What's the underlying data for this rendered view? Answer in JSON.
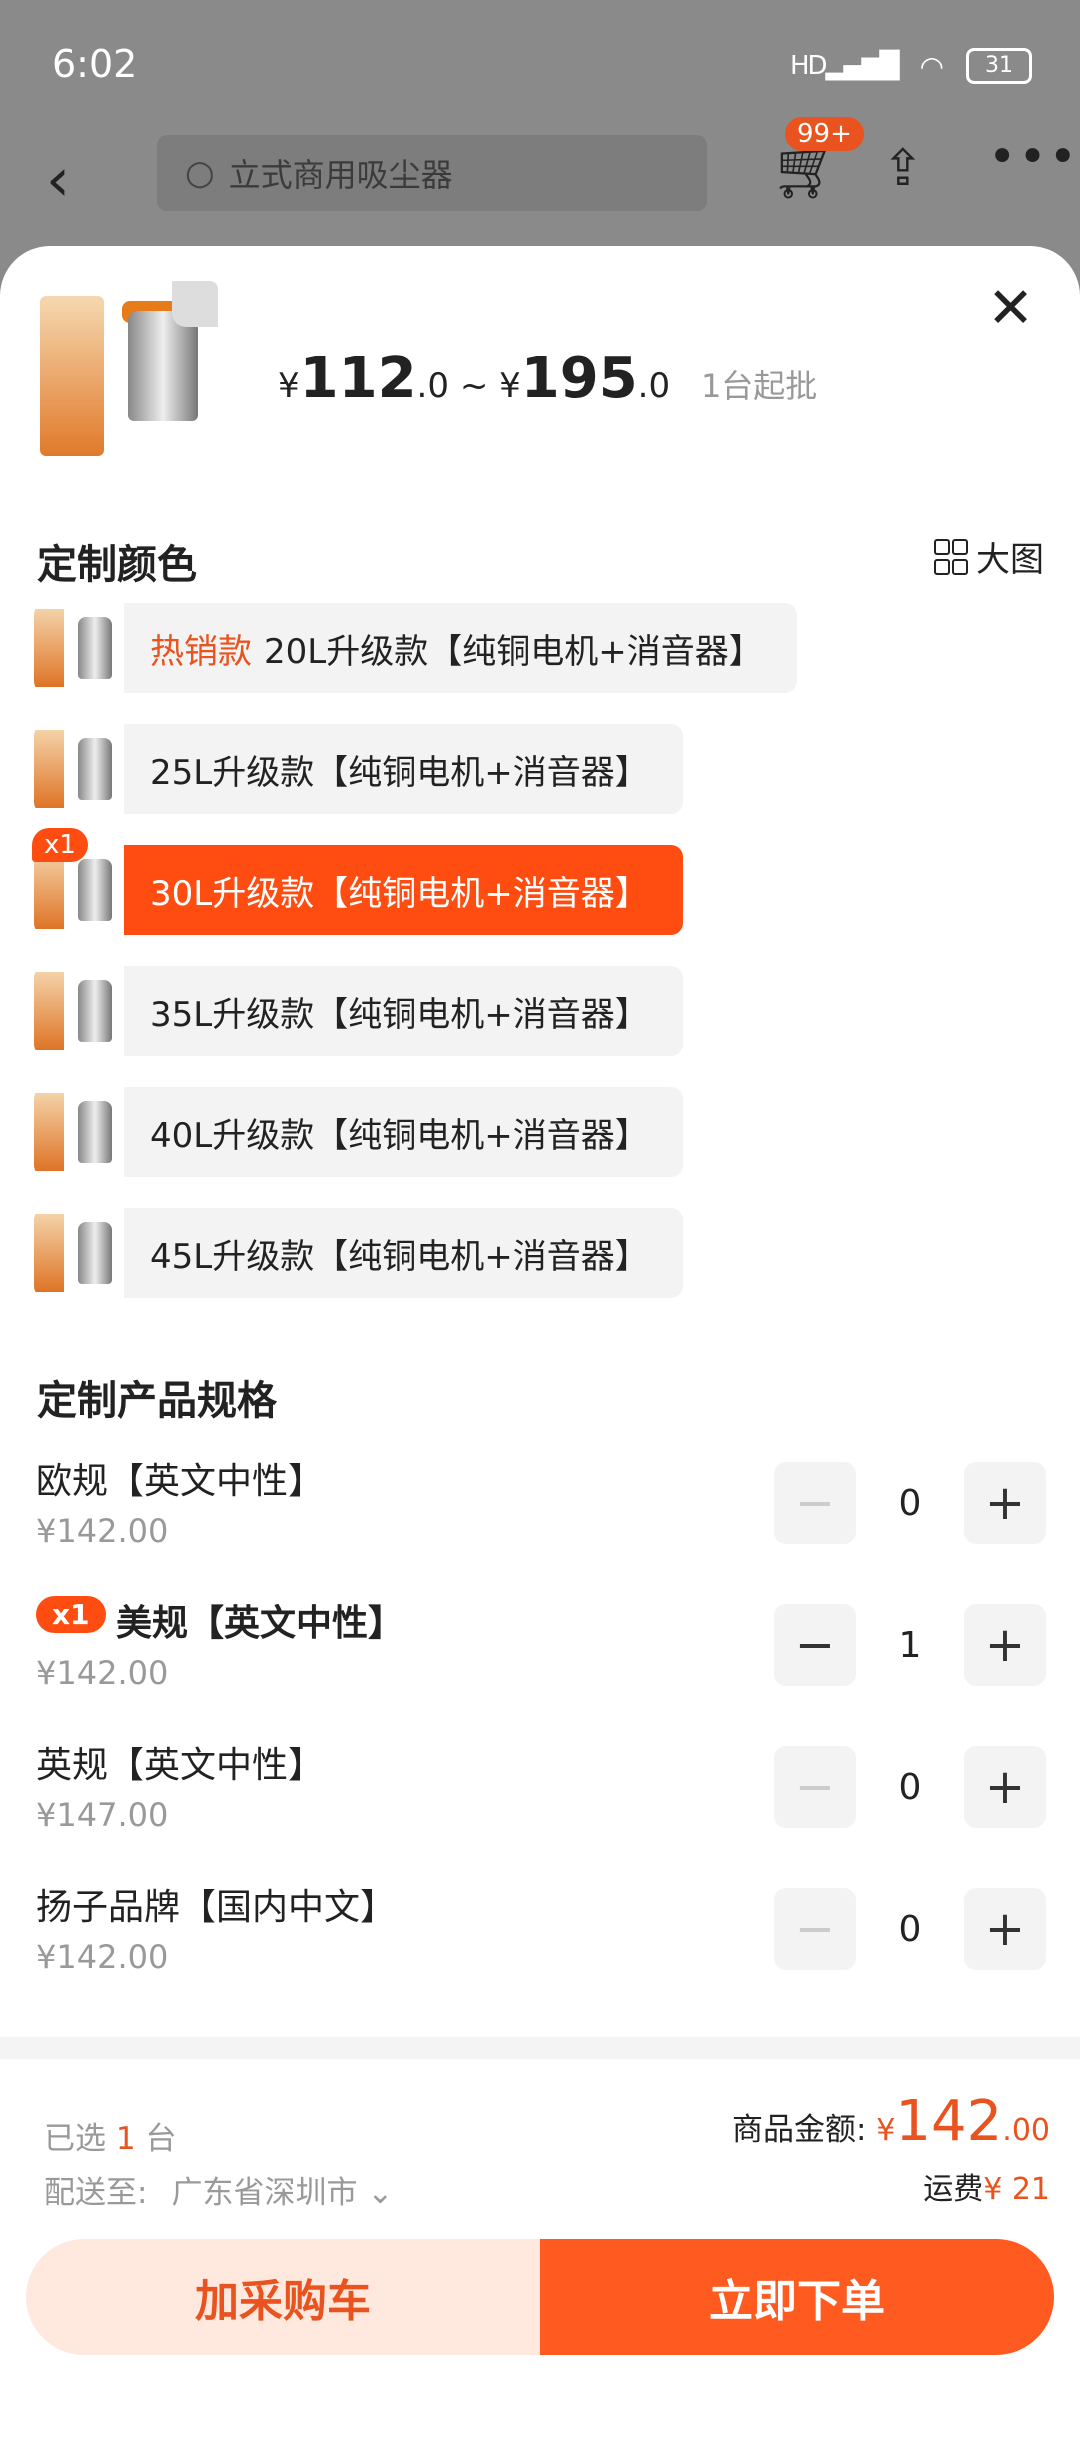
{
  "status_bar": {
    "time": "6:02",
    "network": "HD",
    "battery": "31"
  },
  "top_bar": {
    "search_placeholder": "立式商用吸尘器",
    "cart_badge": "99+"
  },
  "product": {
    "currency": "¥",
    "price_low_int": "112",
    "price_low_dec": ".0",
    "price_sep": "~",
    "price_high_int": "195",
    "price_high_dec": ".0",
    "min_order": "1台起批"
  },
  "color_section": {
    "title": "定制颜色",
    "big_pic_label": "大图",
    "options": [
      {
        "hot": "热销款",
        "label": "20L升级款【纯铜电机+消音器】",
        "selected": false
      },
      {
        "label": "25L升级款【纯铜电机+消音器】",
        "selected": false
      },
      {
        "label": "30L升级款【纯铜电机+消音器】",
        "selected": true,
        "qty_tag": "x1"
      },
      {
        "label": "35L升级款【纯铜电机+消音器】",
        "selected": false
      },
      {
        "label": "40L升级款【纯铜电机+消音器】",
        "selected": false
      },
      {
        "label": "45L升级款【纯铜电机+消音器】",
        "selected": false
      }
    ]
  },
  "spec_section": {
    "title": "定制产品规格",
    "items": [
      {
        "name": "欧规【英文中性】",
        "price": "¥142.00",
        "qty": "0"
      },
      {
        "name": "美规【英文中性】",
        "price": "¥142.00",
        "qty": "1",
        "tag": "x1"
      },
      {
        "name": "英规【英文中性】",
        "price": "¥147.00",
        "qty": "0"
      },
      {
        "name": "扬子品牌【国内中文】",
        "price": "¥142.00",
        "qty": "0"
      }
    ]
  },
  "summary": {
    "chosen_prefix": "已选",
    "chosen_count": "1",
    "chosen_unit": "台",
    "ship_label": "配送至:",
    "ship_city": "广东省深圳市",
    "amount_label": "商品金额:",
    "amount_currency": "¥",
    "amount_int": "142",
    "amount_dec": ".00",
    "freight_label": "运费",
    "freight_value": "¥ 21"
  },
  "actions": {
    "add_cart": "加采购车",
    "buy_now": "立即下单"
  },
  "colors": {
    "accent": "#ff4d12",
    "button_light": "#ffe9df",
    "button_dark": "#ff5a20"
  }
}
